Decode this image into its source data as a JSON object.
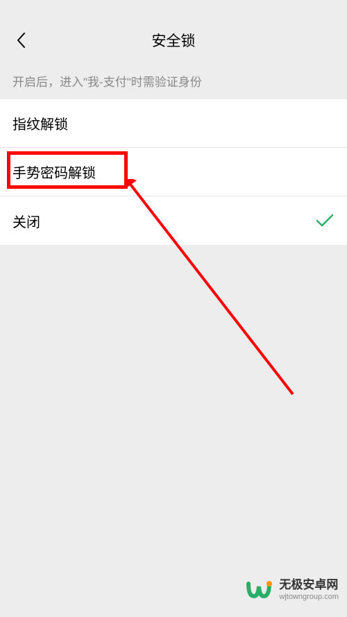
{
  "nav": {
    "title": "安全锁"
  },
  "description": "开启后，进入\"我-支付\"时需验证身份",
  "options": {
    "fingerprint": "指纹解锁",
    "gesture": "手势密码解锁",
    "off": "关闭"
  },
  "watermark": {
    "title": "无极安卓网",
    "sub": "wjtowngroup.com"
  }
}
